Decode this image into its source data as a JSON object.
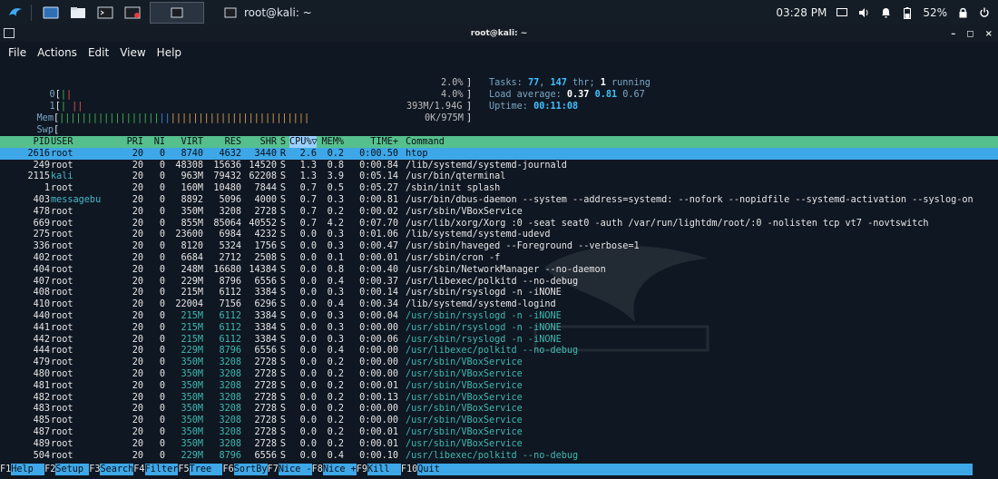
{
  "taskbar": {
    "active_window_title": "root@kali: ~",
    "time": "03:28 PM",
    "battery": "52%"
  },
  "window": {
    "title": "root@kali: ~",
    "controls": [
      "–",
      "◻",
      "×"
    ]
  },
  "menu": [
    "File",
    "Actions",
    "Edit",
    "View",
    "Help"
  ],
  "meters": {
    "cpu0": {
      "label": "0",
      "value": "2.0%"
    },
    "cpu1": {
      "label": "1",
      "value": "4.0%"
    },
    "mem": {
      "label": "Mem",
      "value": "393M/1.94G"
    },
    "swp": {
      "label": "Swp",
      "value": "0K/975M"
    }
  },
  "summary": {
    "tasks_label": "Tasks: ",
    "tasks": "77",
    "threads": "147",
    "thr_label": " thr; ",
    "running": "1",
    "running_label": " running",
    "load_label": "Load average: ",
    "load1": "0.37",
    "load5": "0.81",
    "load15": "0.67",
    "uptime_label": "Uptime: ",
    "uptime": "00:11:08"
  },
  "table": {
    "headers": [
      "PID",
      "USER",
      "PRI",
      "NI",
      "VIRT",
      "RES",
      "SHR",
      "S",
      "CPU%▽",
      "MEM%",
      "TIME+",
      "Command"
    ],
    "rows": [
      [
        "2616",
        "root",
        "20",
        "0",
        "8740",
        "4632",
        "3440",
        "R",
        "2.6",
        "0.2",
        "0:00.50",
        "htop"
      ],
      [
        "249",
        "root",
        "20",
        "0",
        "48308",
        "15636",
        "14520",
        "S",
        "1.3",
        "0.8",
        "0:00.84",
        "/lib/systemd/systemd-journald"
      ],
      [
        "2115",
        "kali",
        "20",
        "0",
        "963M",
        "79432",
        "62208",
        "S",
        "1.3",
        "3.9",
        "0:05.14",
        "/usr/bin/qterminal"
      ],
      [
        "1",
        "root",
        "20",
        "0",
        "160M",
        "10480",
        "7844",
        "S",
        "0.7",
        "0.5",
        "0:05.27",
        "/sbin/init splash"
      ],
      [
        "403",
        "messagebu",
        "20",
        "0",
        "8892",
        "5096",
        "4000",
        "S",
        "0.7",
        "0.3",
        "0:00.81",
        "/usr/bin/dbus-daemon --system --address=systemd: --nofork --nopidfile --systemd-activation --syslog-on"
      ],
      [
        "478",
        "root",
        "20",
        "0",
        "350M",
        "3208",
        "2728",
        "S",
        "0.7",
        "0.2",
        "0:00.02",
        "/usr/sbin/VBoxService"
      ],
      [
        "669",
        "root",
        "20",
        "0",
        "855M",
        "85064",
        "40552",
        "S",
        "0.7",
        "4.2",
        "0:07.70",
        "/usr/lib/xorg/Xorg :0 -seat seat0 -auth /var/run/lightdm/root/:0 -nolisten tcp vt7 -novtswitch"
      ],
      [
        "275",
        "root",
        "20",
        "0",
        "23600",
        "6984",
        "4232",
        "S",
        "0.0",
        "0.3",
        "0:01.06",
        "/lib/systemd/systemd-udevd"
      ],
      [
        "336",
        "root",
        "20",
        "0",
        "8120",
        "5324",
        "1756",
        "S",
        "0.0",
        "0.3",
        "0:00.47",
        "/usr/sbin/haveged --Foreground --verbose=1"
      ],
      [
        "402",
        "root",
        "20",
        "0",
        "6684",
        "2712",
        "2508",
        "S",
        "0.0",
        "0.1",
        "0:00.01",
        "/usr/sbin/cron -f"
      ],
      [
        "404",
        "root",
        "20",
        "0",
        "248M",
        "16680",
        "14384",
        "S",
        "0.0",
        "0.8",
        "0:00.40",
        "/usr/sbin/NetworkManager --no-daemon"
      ],
      [
        "407",
        "root",
        "20",
        "0",
        "229M",
        "8796",
        "6556",
        "S",
        "0.0",
        "0.4",
        "0:00.37",
        "/usr/libexec/polkitd --no-debug"
      ],
      [
        "408",
        "root",
        "20",
        "0",
        "215M",
        "6112",
        "3384",
        "S",
        "0.0",
        "0.3",
        "0:00.14",
        "/usr/sbin/rsyslogd -n -iNONE"
      ],
      [
        "410",
        "root",
        "20",
        "0",
        "22004",
        "7156",
        "6296",
        "S",
        "0.0",
        "0.4",
        "0:00.34",
        "/lib/systemd/systemd-logind"
      ],
      [
        "440",
        "root",
        "20",
        "0",
        "215M",
        "6112",
        "3384",
        "S",
        "0.0",
        "0.3",
        "0:00.04",
        "/usr/sbin/rsyslogd -n -iNONE"
      ],
      [
        "441",
        "root",
        "20",
        "0",
        "215M",
        "6112",
        "3384",
        "S",
        "0.0",
        "0.3",
        "0:00.00",
        "/usr/sbin/rsyslogd -n -iNONE"
      ],
      [
        "442",
        "root",
        "20",
        "0",
        "215M",
        "6112",
        "3384",
        "S",
        "0.0",
        "0.3",
        "0:00.06",
        "/usr/sbin/rsyslogd -n -iNONE"
      ],
      [
        "444",
        "root",
        "20",
        "0",
        "229M",
        "8796",
        "6556",
        "S",
        "0.0",
        "0.4",
        "0:00.00",
        "/usr/libexec/polkitd --no-debug"
      ],
      [
        "479",
        "root",
        "20",
        "0",
        "350M",
        "3208",
        "2728",
        "S",
        "0.0",
        "0.2",
        "0:00.00",
        "/usr/sbin/VBoxService"
      ],
      [
        "480",
        "root",
        "20",
        "0",
        "350M",
        "3208",
        "2728",
        "S",
        "0.0",
        "0.2",
        "0:00.00",
        "/usr/sbin/VBoxService"
      ],
      [
        "481",
        "root",
        "20",
        "0",
        "350M",
        "3208",
        "2728",
        "S",
        "0.0",
        "0.2",
        "0:00.01",
        "/usr/sbin/VBoxService"
      ],
      [
        "482",
        "root",
        "20",
        "0",
        "350M",
        "3208",
        "2728",
        "S",
        "0.0",
        "0.2",
        "0:00.13",
        "/usr/sbin/VBoxService"
      ],
      [
        "483",
        "root",
        "20",
        "0",
        "350M",
        "3208",
        "2728",
        "S",
        "0.0",
        "0.2",
        "0:00.00",
        "/usr/sbin/VBoxService"
      ],
      [
        "485",
        "root",
        "20",
        "0",
        "350M",
        "3208",
        "2728",
        "S",
        "0.0",
        "0.2",
        "0:00.00",
        "/usr/sbin/VBoxService"
      ],
      [
        "487",
        "root",
        "20",
        "0",
        "350M",
        "3208",
        "2728",
        "S",
        "0.0",
        "0.2",
        "0:00.01",
        "/usr/sbin/VBoxService"
      ],
      [
        "489",
        "root",
        "20",
        "0",
        "350M",
        "3208",
        "2728",
        "S",
        "0.0",
        "0.2",
        "0:00.01",
        "/usr/sbin/VBoxService"
      ],
      [
        "504",
        "root",
        "20",
        "0",
        "229M",
        "8796",
        "6556",
        "S",
        "0.0",
        "0.4",
        "0:00.10",
        "/usr/libexec/polkitd --no-debug"
      ]
    ],
    "thread_rows": [
      14,
      15,
      16,
      17,
      18,
      19,
      20,
      21,
      22,
      23,
      24,
      25,
      26
    ],
    "selected_row": 0
  },
  "fkeys": [
    {
      "key": "F1",
      "label": "Help  "
    },
    {
      "key": "F2",
      "label": "Setup "
    },
    {
      "key": "F3",
      "label": "Search"
    },
    {
      "key": "F4",
      "label": "Filter"
    },
    {
      "key": "F5",
      "label": "Tree  "
    },
    {
      "key": "F6",
      "label": "SortBy"
    },
    {
      "key": "F7",
      "label": "Nice -"
    },
    {
      "key": "F8",
      "label": "Nice +"
    },
    {
      "key": "F9",
      "label": "Kill  "
    },
    {
      "key": "F10",
      "label": "Quit"
    }
  ],
  "colors": {
    "header_bg": "#56c08d",
    "selected_bg": "#3ea7e8",
    "terminal_bg": "#0f1722"
  }
}
